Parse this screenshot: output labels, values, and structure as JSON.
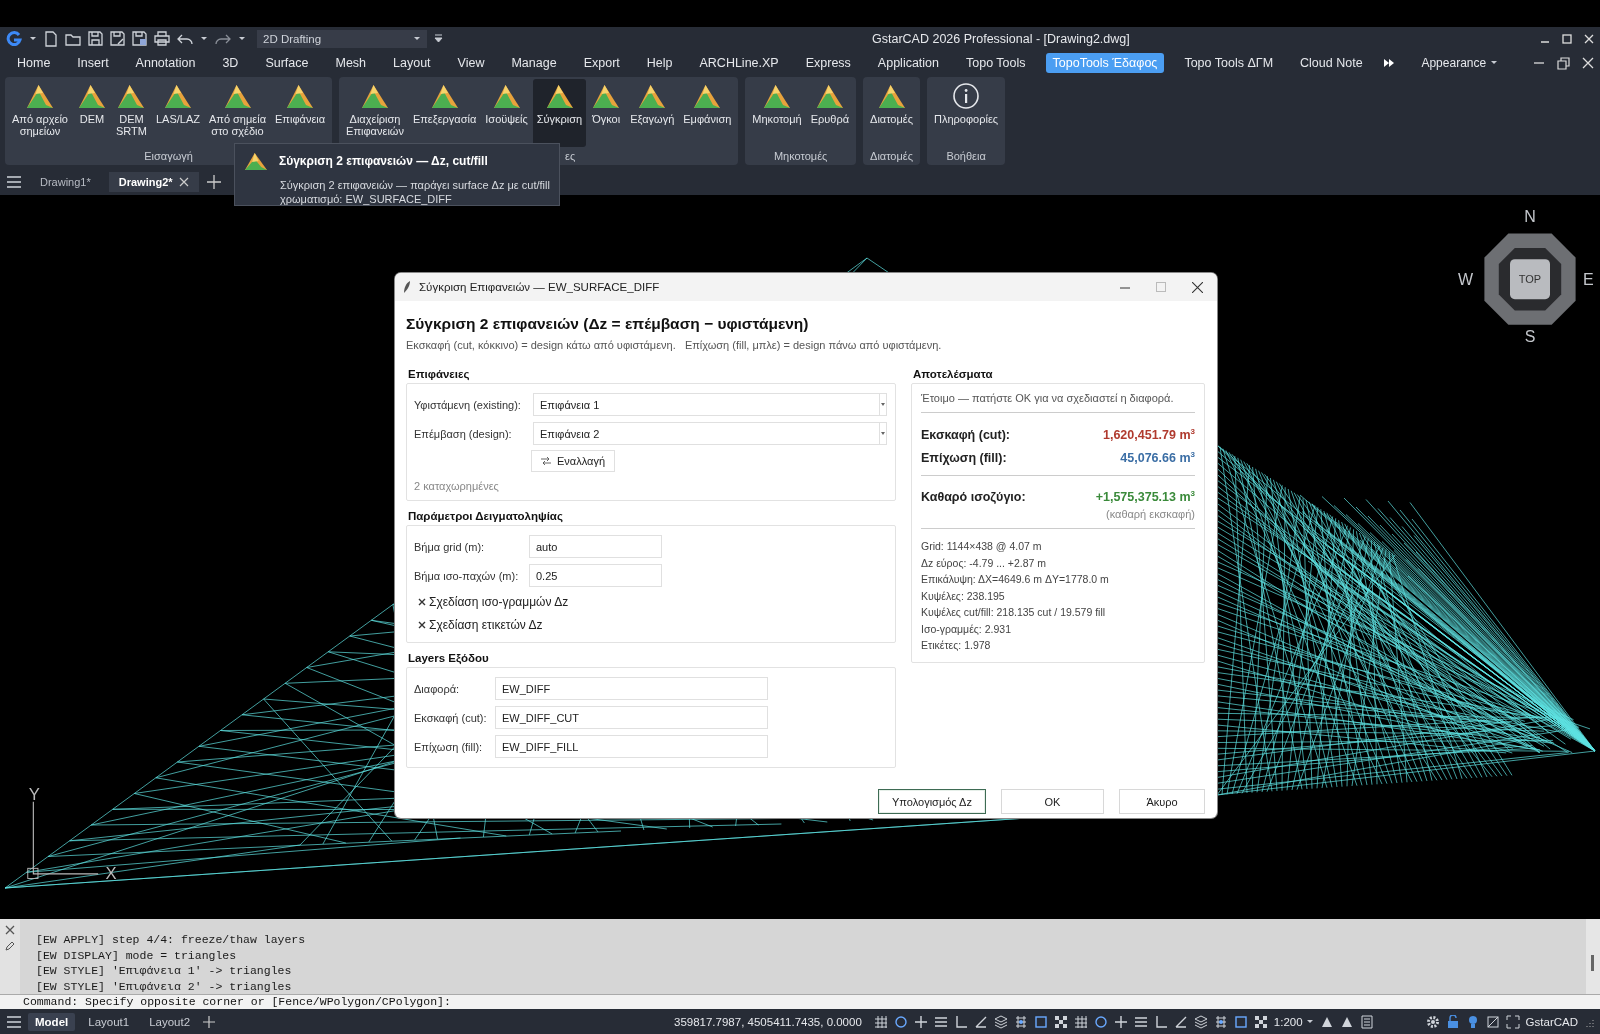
{
  "window": {
    "title": "GstarCAD 2026 Professional - [Drawing2.dwg]",
    "workspace": "2D Drafting"
  },
  "menu_tabs": [
    {
      "label": "Home",
      "selected": false
    },
    {
      "label": "Insert",
      "selected": false
    },
    {
      "label": "Annotation",
      "selected": false
    },
    {
      "label": "3D",
      "selected": false
    },
    {
      "label": "Surface",
      "selected": false
    },
    {
      "label": "Mesh",
      "selected": false
    },
    {
      "label": "Layout",
      "selected": false
    },
    {
      "label": "View",
      "selected": false
    },
    {
      "label": "Manage",
      "selected": false
    },
    {
      "label": "Export",
      "selected": false
    },
    {
      "label": "Help",
      "selected": false
    },
    {
      "label": "ARCHLine.XP",
      "selected": false
    },
    {
      "label": "Express",
      "selected": false
    },
    {
      "label": "Application",
      "selected": false
    },
    {
      "label": "Topo Tools",
      "selected": false
    },
    {
      "label": "TopoTools Έδαφος",
      "selected": true
    },
    {
      "label": "Topo Tools ΔΓΜ",
      "selected": false
    },
    {
      "label": "Cloud Note",
      "selected": false
    }
  ],
  "appearance": "Appearance",
  "ribbon_groups": [
    {
      "label": "Εισαγωγή",
      "items": [
        {
          "label": "Από αρχείο\nσημείων",
          "kind": "tool",
          "selected": false
        },
        {
          "label": "DEM",
          "kind": "tool",
          "selected": false
        },
        {
          "label": "DEM\nSRTM",
          "kind": "tool",
          "selected": false
        },
        {
          "label": "LAS/LAZ",
          "kind": "tool",
          "selected": false
        },
        {
          "label": "Από σημεία\nστο σχέδιο",
          "kind": "tool",
          "selected": false
        },
        {
          "label": "Επιφάνεια",
          "kind": "tool",
          "selected": false
        }
      ]
    },
    {
      "label": "ες",
      "items": [
        {
          "label": "Διαχείριση\nΕπιφανειών",
          "kind": "tool",
          "selected": false
        },
        {
          "label": "Επεξεργασία",
          "kind": "tool",
          "selected": false
        },
        {
          "label": "Ισοϋψείς",
          "kind": "tool",
          "selected": false
        },
        {
          "label": "Σύγκριση",
          "kind": "tool",
          "selected": true
        },
        {
          "label": "Όγκοι",
          "kind": "tool",
          "selected": false
        },
        {
          "label": "Εξαγωγή",
          "kind": "tool",
          "selected": false
        },
        {
          "label": "Εμφάνιση",
          "kind": "tool",
          "selected": false
        }
      ]
    },
    {
      "label": "Μηκοτομές",
      "items": [
        {
          "label": "Μηκοτομή",
          "kind": "tool",
          "selected": false
        },
        {
          "label": "Ερυθρά",
          "kind": "tool",
          "selected": false
        }
      ]
    },
    {
      "label": "Διατομές",
      "items": [
        {
          "label": "Διατομές",
          "kind": "tool",
          "selected": false
        }
      ]
    },
    {
      "label": "Βοήθεια",
      "items": [
        {
          "label": "Πληροφορίες",
          "kind": "info",
          "selected": false
        }
      ]
    }
  ],
  "tooltip": {
    "title": "Σύγκριση 2 επιφανειών — Δz, cut/fill",
    "text": "Σύγκριση 2 επιφανειών — παράγει surface Δz με cut/fill χρωματισμό: EW_SURFACE_DIFF"
  },
  "document_tabs": [
    {
      "label": "Drawing1*",
      "selected": false
    },
    {
      "label": "Drawing2*",
      "selected": true
    }
  ],
  "viewcube": {
    "face": "TOP",
    "north": "N",
    "west": "W",
    "east": "E",
    "south": "S"
  },
  "ucs": {
    "y_label": "Y",
    "x_label": "X"
  },
  "dialog": {
    "title": "Σύγκριση Επιφανειών — EW_SURFACE_DIFF",
    "heading": "Σύγκριση 2 επιφανειών (Δz = επέμβαση − υφιστάμενη)",
    "subtitle": "Εκσκαφή (cut, κόκκινο) = design κάτω από υφιστάμενη.   Επίχωση (fill, μπλε) = design πάνω από υφιστάμενη.",
    "surfaces": {
      "title": "Επιφάνειες",
      "rows": [
        {
          "label": "Υφιστάμενη (existing):",
          "value": "Επιφάνεια 1"
        },
        {
          "label": "Επέμβαση (design):",
          "value": "Επιφάνεια 2"
        }
      ],
      "swap_button": "Εναλλαγή",
      "count": "2 καταχωρημένες"
    },
    "sampling": {
      "title": "Παράμετροι Δειγματοληψίας",
      "fields": [
        {
          "label": "Βήμα grid (m):",
          "value": "auto"
        },
        {
          "label": "Βήμα ισο-παχών (m):",
          "value": "0.25"
        }
      ],
      "options": [
        {
          "label": "Σχεδίαση ισο-γραμμών Δz",
          "checked": true
        },
        {
          "label": "Σχεδίαση ετικετών Δz",
          "checked": true
        }
      ]
    },
    "layers": {
      "title": "Layers Εξόδου",
      "fields": [
        {
          "label": "Διαφορά:",
          "value": "EW_DIFF"
        },
        {
          "label": "Εκσκαφή (cut):",
          "value": "EW_DIFF_CUT"
        },
        {
          "label": "Επίχωση (fill):",
          "value": "EW_DIFF_FILL"
        }
      ]
    },
    "results": {
      "title": "Αποτελέσματα",
      "status": "Έτοιμο — πατήστε OK για να σχεδιαστεί η διαφορά.",
      "totals": [
        {
          "label": "Εκσκαφή (cut):",
          "value": "1,620,451.79 m$^{3}$",
          "color": "#b03a2e"
        },
        {
          "label": "Επίχωση (fill):",
          "value": "45,076.66 m$^{3}$",
          "color": "#3b6ea5"
        }
      ],
      "balance": {
        "label": "Καθαρό ισοζύγιο:",
        "value": "+1,575,375.13 m$^{3}$",
        "color": "#3a8a3a",
        "note": "(καθαρή εκσκαφή)"
      },
      "stats": [
        "Grid: 1144×438 @ 4.07 m",
        "Δz εύρος: -4.79 ... +2.87 m",
        "Επικάλυψη: ΔX=4649.6 m  ΔY=1778.0 m",
        "Κυψέλες: 238.195",
        "Κυψέλες cut/fill: 218.135 cut / 19.579 fill",
        "Ισο-γραμμές: 2.931",
        "Ετικέτες: 1.978"
      ]
    },
    "buttons": [
      {
        "label": "Υπολογισμός Δz",
        "default": true
      },
      {
        "label": "OK",
        "default": false
      },
      {
        "label": "Άκυρο",
        "default": false
      }
    ]
  },
  "command_history": [
    "[EW APPLY] step 4/4: freeze/thaw layers",
    "[EW DISPLAY] mode = triangles",
    "[EW STYLE] 'Επιφάνεια 1' -> triangles",
    "[EW STYLE] 'Επιφάνεια 2' -> triangles"
  ],
  "command_line": "Command: Specify opposite corner or [Fence/WPolygon/CPolygon]:",
  "status_bar": {
    "layout_tabs": [
      {
        "label": "Model",
        "selected": true
      },
      {
        "label": "Layout1",
        "selected": false
      },
      {
        "label": "Layout2",
        "selected": false
      }
    ],
    "coordinates": "359817.7987, 4505411.7435, 0.0000",
    "scale": "1:200",
    "app": "GstarCAD"
  }
}
